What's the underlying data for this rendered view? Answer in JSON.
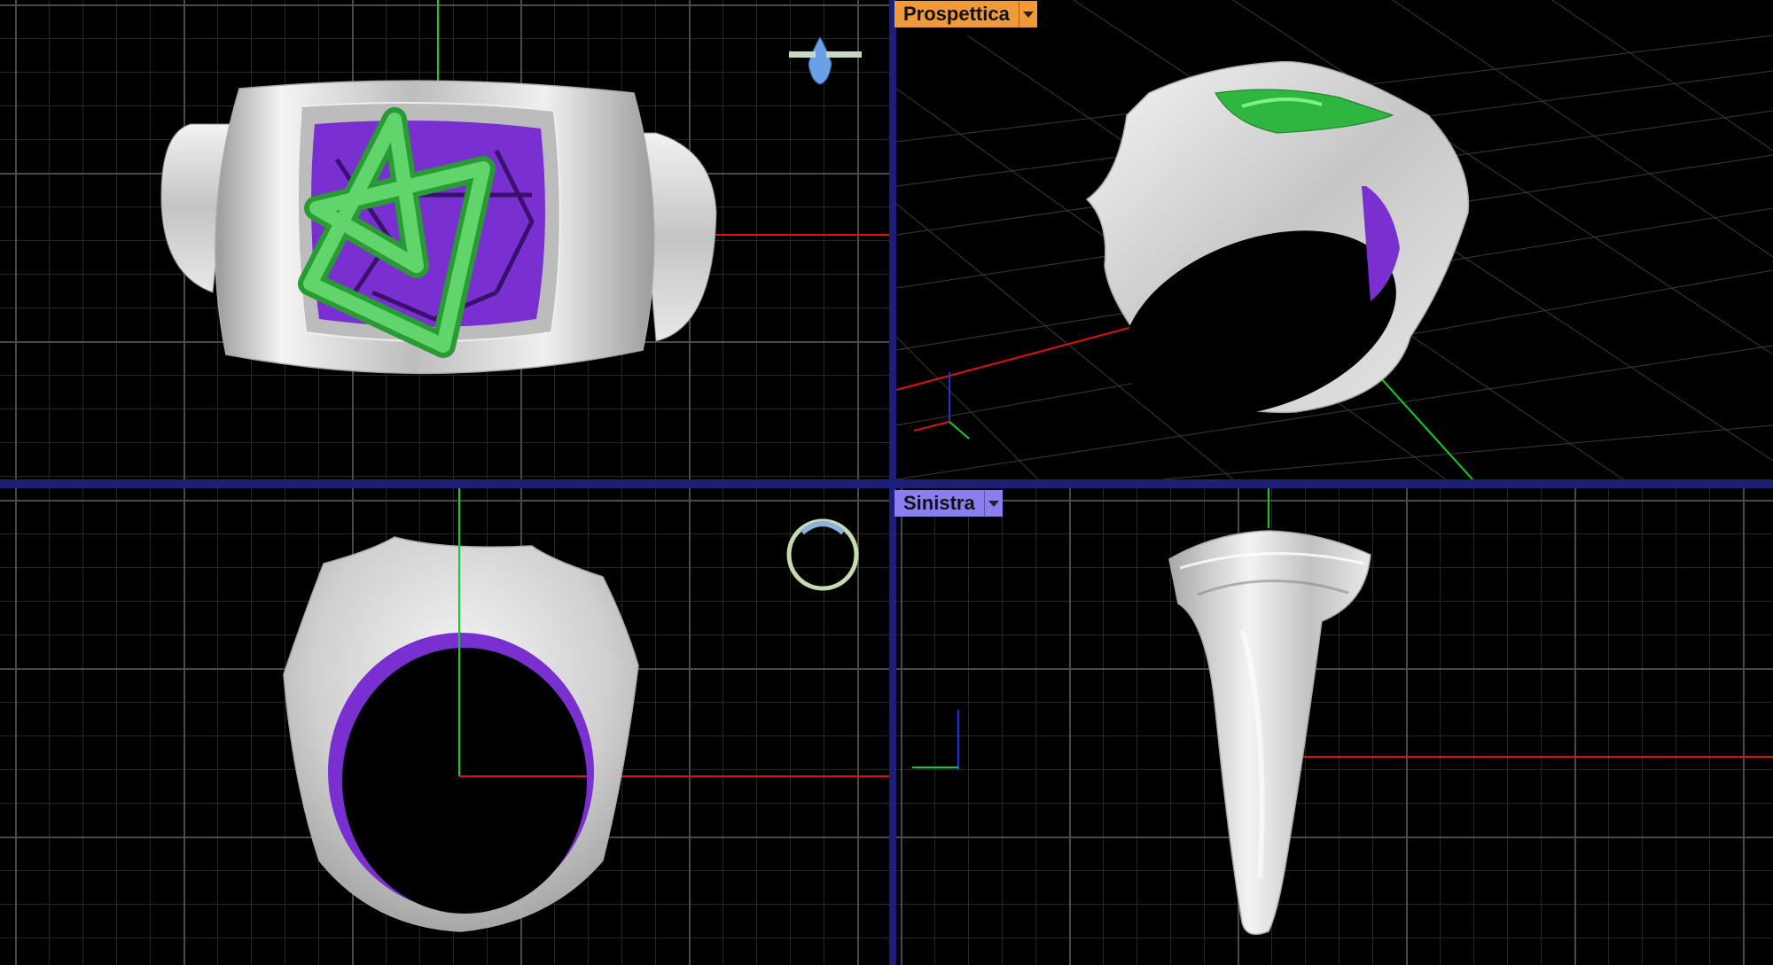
{
  "viewports": {
    "perspective": {
      "label": "Prospettica",
      "label_color": "#f09a3a"
    },
    "left": {
      "label": "Sinistra",
      "label_color": "#8a7ef0"
    }
  },
  "icons": {
    "dropdown": "chevron-down-icon",
    "top_preview": "pear-stone-ring-thumbnail",
    "front_preview": "ring-front-thumbnail"
  },
  "colors": {
    "background": "#000000",
    "separator": "#1c1f7a",
    "x_axis": "#e01010",
    "y_axis": "#10d020",
    "z_axis": "#2030e0",
    "metal": "#d8d8d8",
    "star": "#3fc84a",
    "lattice": "#7a2fd0"
  }
}
